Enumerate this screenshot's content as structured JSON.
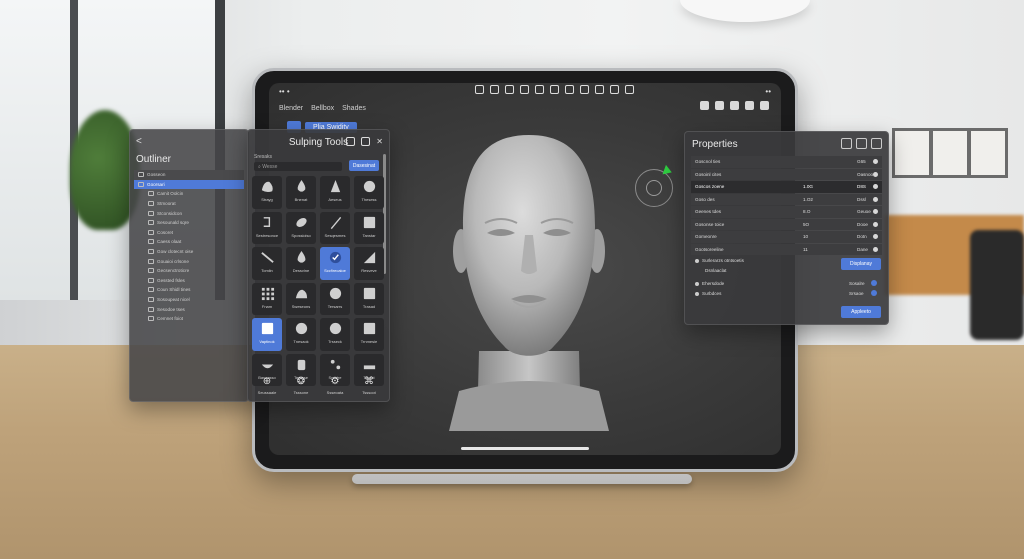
{
  "status": {
    "left": "•• •",
    "right": "••"
  },
  "topbar": {
    "app_label": "Blender",
    "menu1": "Bellbox",
    "menu2": "Shades"
  },
  "sculpt_mode_label": "Plia Swidity",
  "outliner": {
    "back": "<",
    "title": "Outliner",
    "items": [
      {
        "label": "Gosseon",
        "type": "top"
      },
      {
        "label": "Goorsari",
        "type": "sel"
      },
      {
        "label": "Camit Oolcin",
        "type": "child"
      },
      {
        "label": "Stmoorat",
        "type": "child"
      },
      {
        "label": "Stconsidcon",
        "type": "child"
      },
      {
        "label": "Sesounald sqre",
        "type": "child"
      },
      {
        "label": "Cosoret",
        "type": "child"
      },
      {
        "label": "Caess olaat",
        "type": "child"
      },
      {
        "label": "Gow clotecnt oise",
        "type": "child"
      },
      {
        "label": "Gouaioi crlsone",
        "type": "child"
      },
      {
        "label": "Gecsenctroticre",
        "type": "child"
      },
      {
        "label": "Gessted fsles",
        "type": "child"
      },
      {
        "label": "Coun Shidl tines",
        "type": "child"
      },
      {
        "label": "Sosoupeat nicel",
        "type": "child"
      },
      {
        "label": "Sesodoe tses",
        "type": "child"
      },
      {
        "label": "Cemnet foiot",
        "type": "child"
      }
    ]
  },
  "tools": {
    "title": "Sulping Tools",
    "subtitle": "Sresaks",
    "search_value": "Wesse",
    "go_label": "Dasesinat",
    "tiles": [
      {
        "label": "Strayg",
        "shape": "blob",
        "selected": false
      },
      {
        "label": "Bnenat",
        "shape": "drop",
        "selected": false
      },
      {
        "label": "Aeseus",
        "shape": "cone",
        "selected": false
      },
      {
        "label": "Thesess",
        "shape": "sphere",
        "selected": false
      },
      {
        "label": "Sestresonce",
        "shape": "hook",
        "selected": false
      },
      {
        "label": "Spossioiso",
        "shape": "leaf",
        "selected": false
      },
      {
        "label": "Sesqesmes",
        "shape": "blade",
        "selected": false
      },
      {
        "label": "Tanstar",
        "shape": "square",
        "selected": false
      },
      {
        "label": "Tomlin",
        "shape": "pen",
        "selected": false
      },
      {
        "label": "Dessvine",
        "shape": "drop",
        "selected": false
      },
      {
        "label": "Sccfirecaloe",
        "shape": "check",
        "selected": true
      },
      {
        "label": "Resveve",
        "shape": "wedge",
        "selected": false
      },
      {
        "label": "Fnam",
        "shape": "grid",
        "selected": false
      },
      {
        "label": "Sweseons",
        "shape": "lump",
        "selected": false
      },
      {
        "label": "Tersarrs",
        "shape": "sphere",
        "selected": false
      },
      {
        "label": "Trasad",
        "shape": "square",
        "selected": false
      },
      {
        "label": "Vaptinok",
        "shape": "square",
        "selected": true
      },
      {
        "label": "Tnesaok",
        "shape": "sphere",
        "selected": false
      },
      {
        "label": "Trsseck",
        "shape": "sphere",
        "selected": false
      },
      {
        "label": "Trnmesie",
        "shape": "square",
        "selected": false
      },
      {
        "label": "Baseasso",
        "shape": "bowl",
        "selected": false
      },
      {
        "label": "Tersose",
        "shape": "cylinder",
        "selected": false
      },
      {
        "label": "Srcatre",
        "shape": "dots",
        "selected": false
      },
      {
        "label": "Trsent",
        "shape": "flat",
        "selected": false
      }
    ],
    "bottom": [
      {
        "label": "Seussaale",
        "icon": "cross-circle-icon"
      },
      {
        "label": "Tsssone",
        "icon": "swirl-icon"
      },
      {
        "label": "Ssseoata",
        "icon": "gear-icon"
      },
      {
        "label": "Tsssoot",
        "icon": "network-icon"
      }
    ]
  },
  "properties": {
    "title": "Properties",
    "rows": [
      {
        "label": "Goscnol ties",
        "v1": "",
        "v2": "G65",
        "style": "alt"
      },
      {
        "label": "Gosoinl cites",
        "v1": "",
        "v2": "Oasnoo",
        "style": "alt"
      },
      {
        "label": "Goscos zoene",
        "v1": "1.0G",
        "v2": "D8S",
        "style": "hi"
      },
      {
        "label": "Goso des",
        "v1": "1.O2",
        "v2": "Dssl",
        "style": "alt"
      },
      {
        "label": "Geenes tdes",
        "v1": "8.O",
        "v2": "Geuoe",
        "style": "alt"
      },
      {
        "label": "Gosonse toice",
        "v1": "5O",
        "v2": "Dooe",
        "style": "alt"
      },
      {
        "label": "Gomeonre",
        "v1": "10",
        "v2": "Dotn",
        "style": "alt"
      },
      {
        "label": "Gootsoreeline",
        "v1": "11",
        "v2": "Dane",
        "style": "alt"
      }
    ],
    "opt1": "Surlerarzs otntsoetis",
    "opt1_sub": "Dsnlaaclat",
    "opt1_btn": "Displanay",
    "opt2": "Ehersdode",
    "opt2_val": "Sosalre",
    "opt3": "Surbdces",
    "opt3_val": "Srsaoe",
    "apply_btn": "Appleeto"
  }
}
